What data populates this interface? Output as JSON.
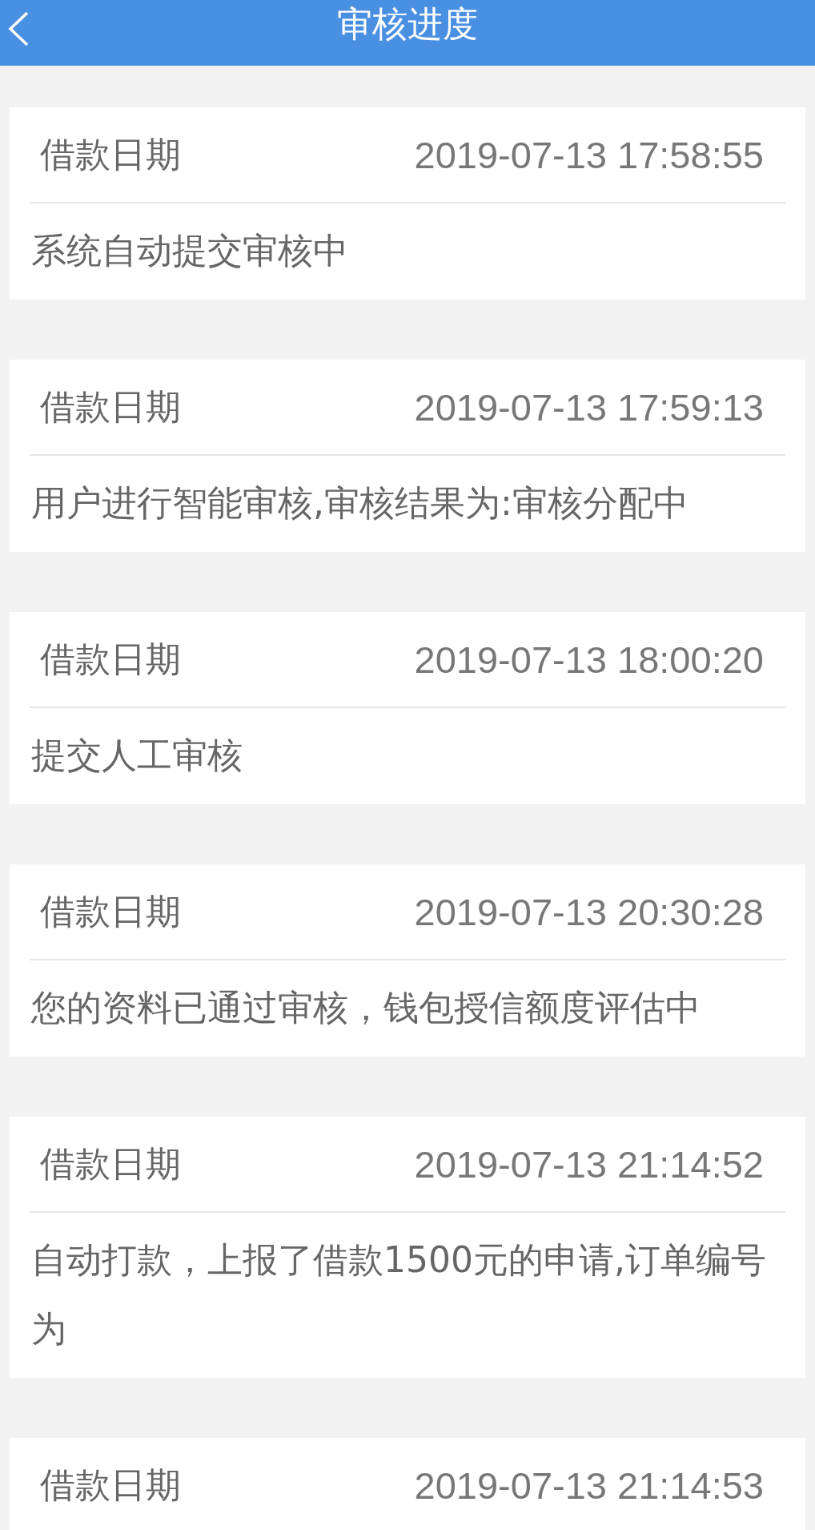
{
  "header": {
    "title": "审核进度"
  },
  "records": [
    {
      "label": "借款日期",
      "date": "2019-07-13 17:58:55",
      "text": "系统自动提交审核中"
    },
    {
      "label": "借款日期",
      "date": "2019-07-13 17:59:13",
      "text": "用户进行智能审核,审核结果为:审核分配中"
    },
    {
      "label": "借款日期",
      "date": "2019-07-13 18:00:20",
      "text": "提交人工审核"
    },
    {
      "label": "借款日期",
      "date": "2019-07-13 20:30:28",
      "text": "您的资料已通过审核，钱包授信额度评估中"
    },
    {
      "label": "借款日期",
      "date": "2019-07-13 21:14:52",
      "text": "自动打款，上报了借款1500元的申请,订单编号为"
    },
    {
      "label": "借款日期",
      "date": "2019-07-13 21:14:53"
    }
  ]
}
